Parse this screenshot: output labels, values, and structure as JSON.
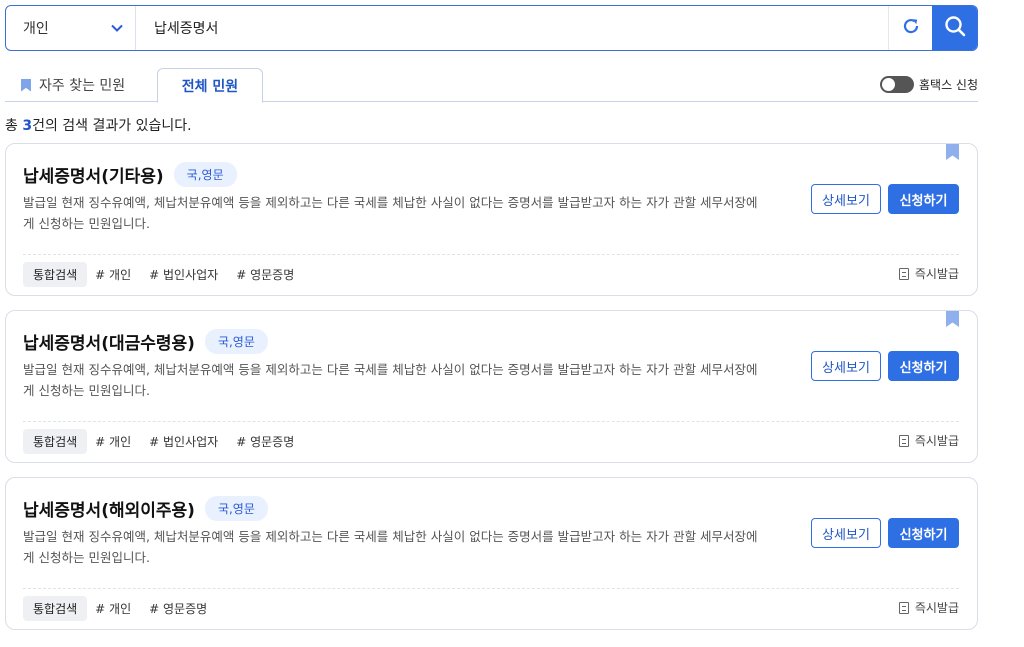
{
  "search": {
    "category": "개인",
    "query": "납세증명서"
  },
  "tabs": {
    "favorites": "자주 찾는 민원",
    "all": "전체 민원"
  },
  "hometax_toggle": {
    "label": "홈택스 신청",
    "on": false
  },
  "result": {
    "prefix": "총 ",
    "count": "3",
    "suffix": "건의 검색 결과가 있습니다."
  },
  "buttons": {
    "detail": "상세보기",
    "apply": "신청하기"
  },
  "colors": {
    "accent": "#2f6fe4",
    "badge_bg": "#e9f1ff"
  },
  "cards": [
    {
      "title": "납세증명서(기타용)",
      "lang": "국,영문",
      "desc": "발급일 현재 징수유예액, 체납처분유예액 등을 제외하고는 다른 국세를 체납한 사실이 없다는 증명서를 발급받고자 하는 자가 관할 세무서장에게 신청하는 민원입니다.",
      "primary_tag": "통합검색",
      "tags": [
        "# 개인",
        "# 법인사업자",
        "# 영문증명"
      ],
      "issue": "즉시발급"
    },
    {
      "title": "납세증명서(대금수령용)",
      "lang": "국,영문",
      "desc": "발급일 현재 징수유예액, 체납처분유예액 등을 제외하고는 다른 국세를 체납한 사실이 없다는 증명서를 발급받고자 하는 자가 관할 세무서장에게 신청하는 민원입니다.",
      "primary_tag": "통합검색",
      "tags": [
        "# 개인",
        "# 법인사업자",
        "# 영문증명"
      ],
      "issue": "즉시발급"
    },
    {
      "title": "납세증명서(해외이주용)",
      "lang": "국,영문",
      "desc": "발급일 현재 징수유예액, 체납처분유예액 등을 제외하고는 다른 국세를 체납한 사실이 없다는 증명서를 발급받고자 하는 자가 관할 세무서장에게 신청하는 민원입니다.",
      "primary_tag": "통합검색",
      "tags": [
        "# 개인",
        "# 영문증명"
      ],
      "issue": "즉시발급"
    }
  ]
}
